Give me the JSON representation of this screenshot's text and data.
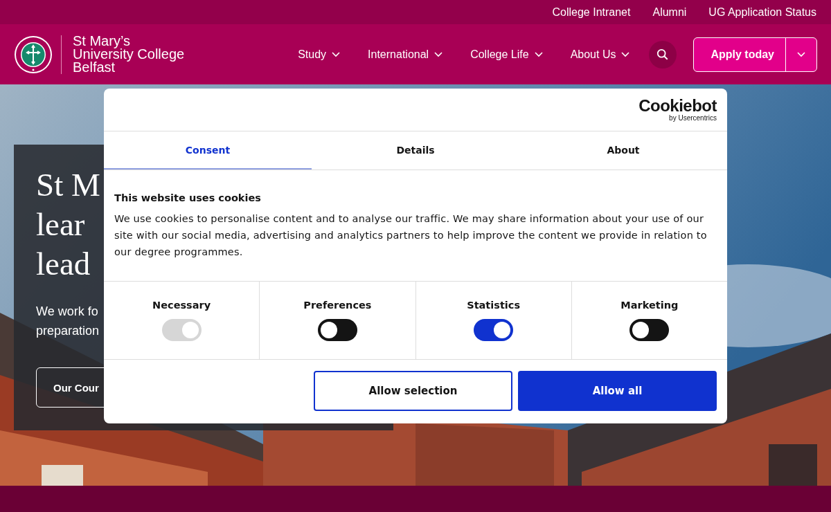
{
  "top_links": [
    "College Intranet",
    "Alumni",
    "UG Application Status"
  ],
  "brand": {
    "name_lines": [
      "St Mary’s",
      "University College",
      "Belfast"
    ]
  },
  "nav": [
    "Study",
    "International",
    "College Life",
    "About Us"
  ],
  "apply_button": "Apply today",
  "hero": {
    "heading_lines": [
      "St M",
      "lear",
      "lead"
    ],
    "text_lines": [
      "We work fo",
      "preparation"
    ],
    "button": "Our Cour"
  },
  "cookie_dialog": {
    "logo": "Cookiebot",
    "logo_sub": "by Usercentrics",
    "tabs": [
      {
        "label": "Consent",
        "selected": true
      },
      {
        "label": "Details",
        "selected": false
      },
      {
        "label": "About",
        "selected": false
      }
    ],
    "title": "This website uses cookies",
    "text": "We use cookies to personalise content and to analyse our traffic. We may share information about your use of our site with our social media, advertising and analytics partners to help improve the content we provide in relation to our degree programmes.",
    "toggles": [
      {
        "label": "Necessary",
        "checked": true,
        "disabled": true
      },
      {
        "label": "Preferences",
        "checked": false,
        "disabled": false
      },
      {
        "label": "Statistics",
        "checked": true,
        "disabled": false
      },
      {
        "label": "Marketing",
        "checked": false,
        "disabled": false
      }
    ],
    "buttons": [
      {
        "label": "Allow selection",
        "kind": "outline"
      },
      {
        "label": "Allow all",
        "kind": "primary"
      }
    ]
  }
}
